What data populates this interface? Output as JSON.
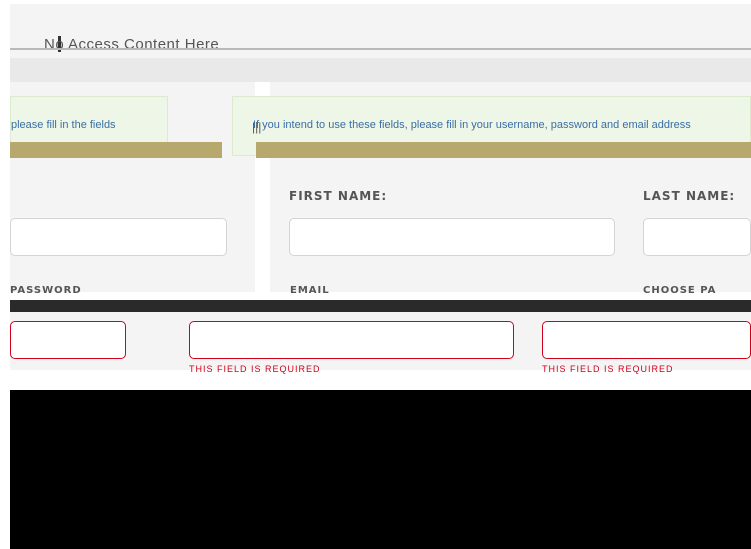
{
  "header": {
    "title": "No Access Content Here",
    "icon": "menu-icon"
  },
  "notices": {
    "left_text": "please fill in the fields",
    "right_text": "If you intend to use these fields, please fill in your username, password and email address"
  },
  "form": {
    "first_name_label": "FIRST NAME:",
    "last_name_label": "LAST NAME:",
    "password_label": "PASSWORD",
    "email_label": "EMAIL",
    "choose_label": "CHOOSE PA",
    "first_name_value": "",
    "last_name_value": "",
    "left_value": "",
    "password_value": "",
    "email_value": "",
    "choose_value": "",
    "email_error": "THIS FIELD IS REQUIRED",
    "choose_error": "THIS FIELD IS REQUIRED"
  },
  "colors": {
    "error": "#d0021b",
    "notice_bg": "#eef6e7",
    "panel_bg": "#f4f4f4"
  }
}
